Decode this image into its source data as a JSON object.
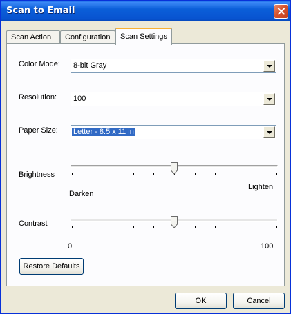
{
  "window": {
    "title": "Scan to Email"
  },
  "tabs": [
    {
      "label": "Scan Action",
      "active": false
    },
    {
      "label": "Configuration",
      "active": false
    },
    {
      "label": "Scan Settings",
      "active": true
    }
  ],
  "color_mode": {
    "label": "Color Mode:",
    "value": "8-bit Gray"
  },
  "resolution": {
    "label": "Resolution:",
    "value": "100"
  },
  "paper_size": {
    "label": "Paper Size:",
    "value": "Letter - 8.5  x 11 in"
  },
  "brightness": {
    "label": "Brightness",
    "min_label": "Darken",
    "max_label": "Lighten",
    "level": 0.5
  },
  "contrast": {
    "label": "Contrast",
    "min_label": "0",
    "max_label": "100",
    "level": 0.5
  },
  "buttons": {
    "restore": "Restore Defaults",
    "ok": "OK",
    "cancel": "Cancel"
  },
  "icons": {
    "close": "close-icon",
    "dropdown": "chevron-down-icon"
  },
  "colors": {
    "titlebar": "#0b5fd9",
    "dialog_bg": "#ece9d8",
    "panel_bg": "#fcfcfe",
    "selection": "#316ac5"
  }
}
